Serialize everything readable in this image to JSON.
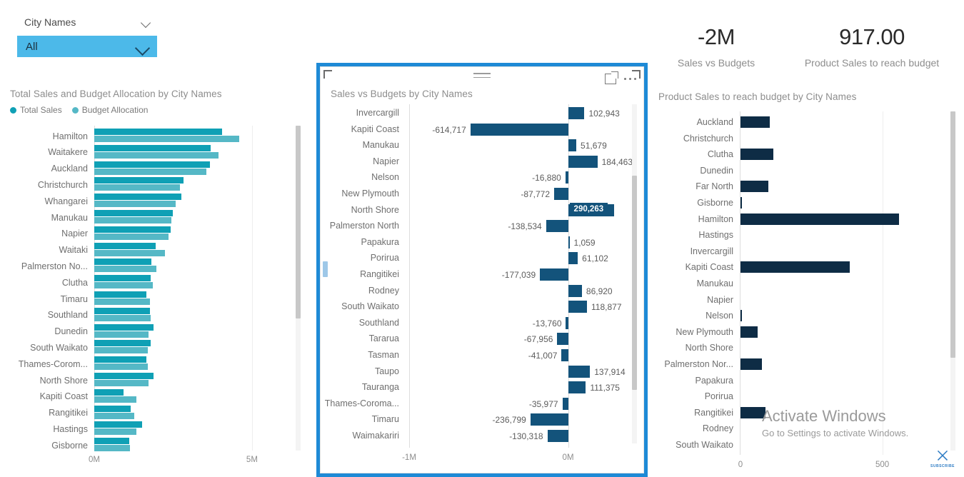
{
  "slicer": {
    "field_label": "City Names",
    "selected_value": "All",
    "chevron_icon": "chevron-down-icon",
    "accent_color": "#4CB9E9"
  },
  "left_visual": {
    "title": "Total Sales and Budget Allocation by City Names",
    "legend": [
      {
        "label": "Total Sales",
        "color": "#0FA0B5"
      },
      {
        "label": "Budget Allocation",
        "color": "#55B8C6"
      }
    ],
    "chart_data": {
      "type": "bar",
      "orientation": "horizontal",
      "title": "Total Sales and Budget Allocation by City Names",
      "xlabel": "",
      "ylabel": "City Names",
      "xlim": [
        0,
        6.45
      ],
      "xticks": [
        "0M",
        "5M"
      ],
      "xtick_values": [
        0,
        5
      ],
      "grid": false,
      "categories": [
        "Hamilton",
        "Waitakere",
        "Auckland",
        "Christchurch",
        "Whangarei",
        "Manukau",
        "Napier",
        "Waitaki",
        "Palmerston No...",
        "Clutha",
        "Timaru",
        "Southland",
        "Dunedin",
        "South Waikato",
        "Thames-Corom...",
        "North Shore",
        "Kapiti Coast",
        "Rangitikei",
        "Hastings",
        "Gisborne"
      ],
      "series": [
        {
          "name": "Total Sales",
          "color": "#0FA0B5",
          "values": [
            4.05,
            3.7,
            3.67,
            2.83,
            2.76,
            2.49,
            2.43,
            1.94,
            1.82,
            1.79,
            1.65,
            1.77,
            1.87,
            1.79,
            1.66,
            1.88,
            0.92,
            1.15,
            1.51,
            1.11
          ]
        },
        {
          "name": "Budget Allocation",
          "color": "#55B8C6",
          "values": [
            4.6,
            3.94,
            3.55,
            2.72,
            2.58,
            2.45,
            2.36,
            2.23,
            1.98,
            1.85,
            1.77,
            1.78,
            1.72,
            1.69,
            1.7,
            1.73,
            1.33,
            1.26,
            1.34,
            1.14
          ]
        }
      ]
    }
  },
  "center_visual": {
    "title": "Sales vs Budgets by City Names",
    "selected": true,
    "selection_color": "#1E8AD6",
    "header_icons": [
      "drag-handle-icon",
      "focus-mode-icon",
      "more-options-icon"
    ],
    "hovered_category": "North Shore",
    "chart_data": {
      "type": "bar",
      "orientation": "horizontal",
      "title": "Sales vs Budgets by City Names",
      "xlabel": "",
      "ylabel": "City Names",
      "xlim": [
        -1000000,
        330000
      ],
      "xticks": [
        "-1M",
        "0M"
      ],
      "xtick_values": [
        -1000000,
        0
      ],
      "grid": false,
      "bar_color": "#13537B",
      "categories": [
        "Invercargill",
        "Kapiti Coast",
        "Manukau",
        "Napier",
        "Nelson",
        "New Plymouth",
        "North Shore",
        "Palmerston North",
        "Papakura",
        "Porirua",
        "Rangitikei",
        "Rodney",
        "South Waikato",
        "Southland",
        "Tararua",
        "Tasman",
        "Taupo",
        "Tauranga",
        "Thames-Coroma...",
        "Timaru",
        "Waimakariri"
      ],
      "values": [
        102943,
        -614717,
        51679,
        184463,
        -16880,
        -87772,
        290263,
        -138534,
        1059,
        61102,
        -177039,
        86920,
        118877,
        -13760,
        -67956,
        -41007,
        137914,
        111375,
        -35977,
        -236799,
        -130318
      ],
      "value_labels": [
        "102,943",
        "-614,717",
        "51,679",
        "184,463",
        "-16,880",
        "-87,772",
        "290,263",
        "-138,534",
        "1,059",
        "61,102",
        "-177,039",
        "86,920",
        "118,877",
        "-13,760",
        "-67,956",
        "-41,007",
        "137,914",
        "111,375",
        "-35,977",
        "-236,799",
        "-130,318"
      ]
    }
  },
  "kpis": [
    {
      "value": "-2M",
      "label": "Sales vs Budgets"
    },
    {
      "value": "917.00",
      "label": "Product Sales to reach budget"
    }
  ],
  "right_visual": {
    "title": "Product Sales to reach budget by City Names",
    "chart_data": {
      "type": "bar",
      "orientation": "horizontal",
      "title": "Product Sales to reach budget by City Names",
      "xlabel": "",
      "ylabel": "City Names",
      "xlim": [
        0,
        700
      ],
      "xticks": [
        "0",
        "500"
      ],
      "xtick_values": [
        0,
        500
      ],
      "grid": true,
      "bar_color": "#0E2C45",
      "categories": [
        "Auckland",
        "Christchurch",
        "Clutha",
        "Dunedin",
        "Far North",
        "Gisborne",
        "Hamilton",
        "Hastings",
        "Invercargill",
        "Kapiti Coast",
        "Manukau",
        "Napier",
        "Nelson",
        "New Plymouth",
        "North Shore",
        "Palmerston Nor...",
        "Papakura",
        "Porirua",
        "Rangitikei",
        "Rodney",
        "South Waikato"
      ],
      "values": [
        102,
        0,
        117,
        0,
        97,
        4,
        560,
        0,
        0,
        385,
        0,
        0,
        5,
        60,
        0,
        76,
        0,
        0,
        88,
        0,
        0
      ]
    }
  },
  "watermark": {
    "line1": "Activate Windows",
    "line2": "Go to Settings to activate Windows."
  },
  "subscribe_badge": {
    "glyph": "⨉",
    "label": "SUBSCRIBE"
  }
}
